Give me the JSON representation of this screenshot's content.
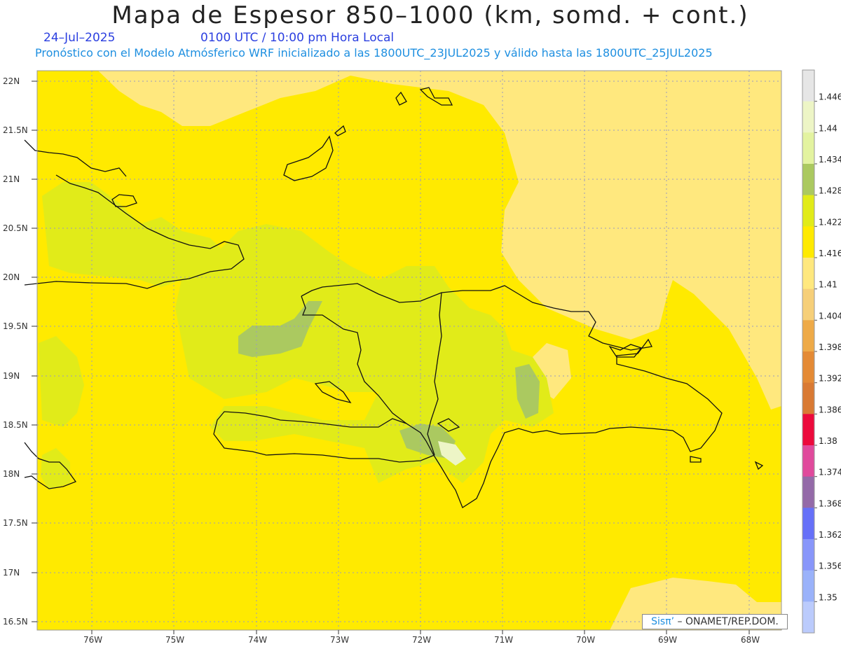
{
  "title": "Mapa de Espesor 850–1000 (km, somd. + cont.)",
  "date": "24–Jul–2025",
  "time": "0100 UTC / 10:00 pm Hora Local",
  "forecast": "Pronóstico con el Modelo Atmósferico WRF inicializado a las 1800UTC_23JUL2025 y válido hasta las  1800UTC_25JUL2025",
  "credit": {
    "brand": "Sisπ’",
    "text": " – ONAMET/REP.DOM."
  },
  "map": {
    "lat_ticks": [
      "22N",
      "21.5N",
      "21N",
      "20.5N",
      "20N",
      "19.5N",
      "19N",
      "18.5N",
      "18N",
      "17.5N",
      "17N",
      "16.5N"
    ],
    "lon_ticks": [
      "76W",
      "75W",
      "74W",
      "73W",
      "72W",
      "71W",
      "70W",
      "69W",
      "68W"
    ],
    "fill_colors": {
      "low": "#ffe87e",
      "mid": "#ffea00",
      "high": "#e1eb19",
      "higher": "#abc960",
      "top": "#edf5c6"
    }
  },
  "colorbar": {
    "levels": [
      "1.446",
      "1.44",
      "1.434",
      "1.428",
      "1.422",
      "1.416",
      "1.41",
      "1.404",
      "1.398",
      "1.392",
      "1.386",
      "1.38",
      "1.374",
      "1.368",
      "1.362",
      "1.356",
      "1.35"
    ],
    "colors": [
      "#e6e6e6",
      "#edf5c6",
      "#e3f3a0",
      "#abc960",
      "#e1eb19",
      "#ffea00",
      "#ffe87e",
      "#f6cf79",
      "#eeaa48",
      "#e48a35",
      "#d97a34",
      "#ec0a3c",
      "#e04a9c",
      "#946aa8",
      "#6670f8",
      "#8896fa",
      "#9ab2fa",
      "#bbcbfc"
    ]
  }
}
